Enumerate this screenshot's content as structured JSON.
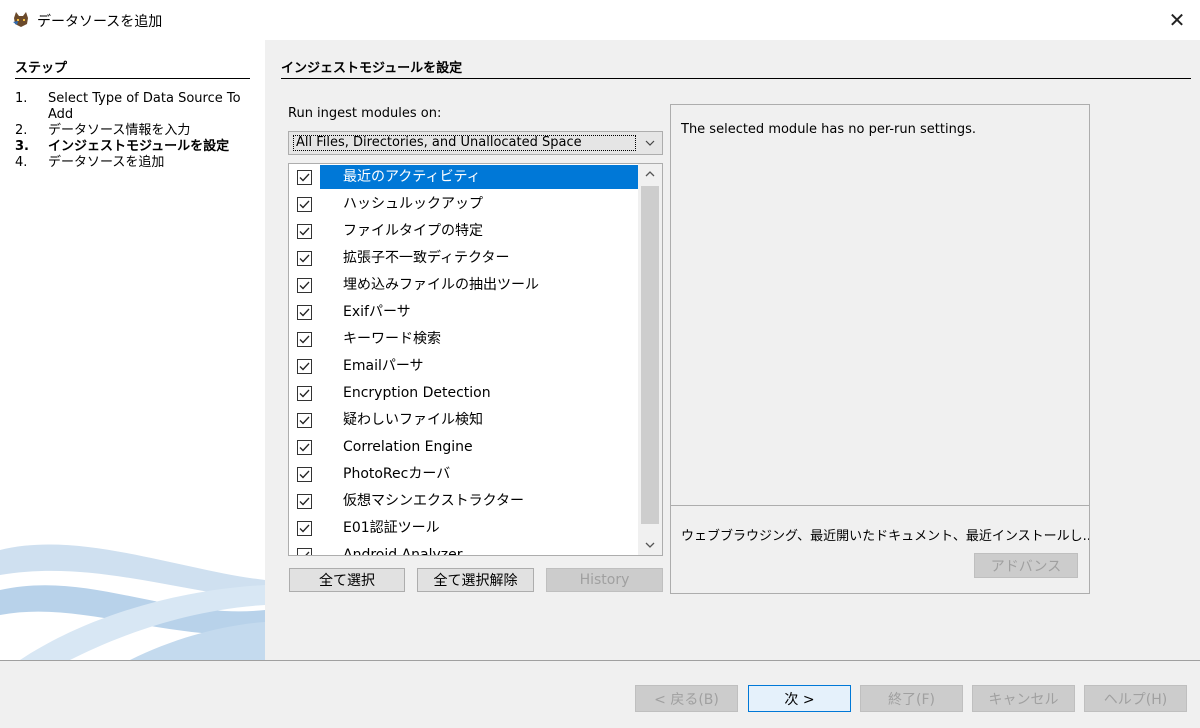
{
  "window": {
    "title": "データソースを追加",
    "close_icon": "close-icon"
  },
  "steps": {
    "header": "ステップ",
    "items": [
      {
        "num": "1.",
        "label": "Select Type of Data Source To Add"
      },
      {
        "num": "2.",
        "label": "データソース情報を入力"
      },
      {
        "num": "3.",
        "label": "インジェストモジュールを設定"
      },
      {
        "num": "4.",
        "label": "データソースを追加"
      }
    ],
    "current_index": 2
  },
  "main": {
    "section_title": "インジェストモジュールを設定",
    "run_label": "Run ingest modules on:",
    "run_selected": "All Files, Directories, and Unallocated Space",
    "modules": [
      {
        "label": "最近のアクティビティ",
        "checked": true,
        "selected": true
      },
      {
        "label": "ハッシュルックアップ",
        "checked": true
      },
      {
        "label": "ファイルタイプの特定",
        "checked": true
      },
      {
        "label": "拡張子不一致ディテクター",
        "checked": true
      },
      {
        "label": "埋め込みファイルの抽出ツール",
        "checked": true
      },
      {
        "label": "Exifパーサ",
        "checked": true
      },
      {
        "label": "キーワード検索",
        "checked": true
      },
      {
        "label": "Emailパーサ",
        "checked": true
      },
      {
        "label": "Encryption Detection",
        "checked": true
      },
      {
        "label": "疑わしいファイル検知",
        "checked": true
      },
      {
        "label": "Correlation Engine",
        "checked": true
      },
      {
        "label": "PhotoRecカーバ",
        "checked": true
      },
      {
        "label": "仮想マシンエクストラクター",
        "checked": true
      },
      {
        "label": "E01認証ツール",
        "checked": true
      },
      {
        "label": "Android Analyzer",
        "checked": true
      }
    ],
    "select_all": "全て選択",
    "deselect_all": "全て選択解除",
    "history": "History",
    "settings_message": "The selected module has no per-run settings.",
    "module_description": "ウェブブラウジング、最近開いたドキュメント、最近インストールし...",
    "advanced": "アドバンス"
  },
  "footer": {
    "back": "< 戻る(B)",
    "next": "次 >",
    "finish": "終了(F)",
    "cancel": "キャンセル",
    "help": "ヘルプ(H)"
  }
}
